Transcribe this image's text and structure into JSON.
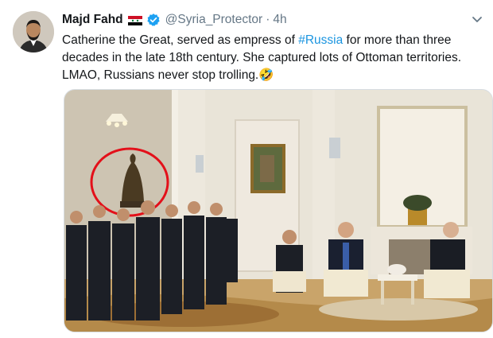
{
  "tweet": {
    "author_name": "Majd Fahd",
    "handle": "@Syria_Protector",
    "separator": "·",
    "time": "4h",
    "text_part1": "Catherine the Great, served as empress of ",
    "hashtag": "#Russia",
    "text_part2": " for more than three decades in the late 18th century. She captured lots of Ottoman territories. LMAO, Russians never stop trolling.",
    "emoji": "🤣"
  },
  "icons": {
    "flag": "syria-flag-icon",
    "verified": "verified-badge-icon",
    "menu": "chevron-down-icon"
  },
  "colors": {
    "link": "#1b95e0",
    "secondary_text": "#657786",
    "verified": "#1da1f2",
    "highlight_circle": "#e3101a"
  }
}
